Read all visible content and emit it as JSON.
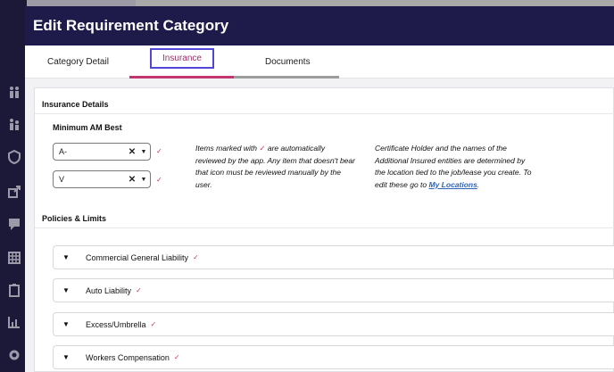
{
  "modal": {
    "title": "Edit Requirement Category"
  },
  "tabs": [
    {
      "label": "Category Detail",
      "active": false
    },
    {
      "label": "Insurance",
      "active": true
    },
    {
      "label": "Documents",
      "active": false
    }
  ],
  "insurance_details": {
    "heading": "Insurance Details",
    "min_am_best_label": "Minimum AM Best",
    "rating_select": {
      "value": "A-"
    },
    "size_select": {
      "value": "V"
    },
    "clear_glyph": "✕",
    "caret_glyph": "▼",
    "auto_review_glyph": "✓",
    "note_left_part1": "Items marked with",
    "note_left_part2": "are automatically reviewed by the app. Any item that doesn't bear that icon must be reviewed manually by the user.",
    "note_right_text": "Certificate Holder and the names of the Additional Insured entities are determined by the location tied to the job/lease you create. To edit these go to",
    "note_right_link": "My Locations",
    "note_right_end": "."
  },
  "policies": {
    "heading": "Policies & Limits",
    "items": [
      {
        "label": "Commercial General Liability",
        "expand_glyph": "▼"
      },
      {
        "label": "Auto Liability",
        "expand_glyph": "▼"
      },
      {
        "label": "Excess/Umbrella",
        "expand_glyph": "▼"
      },
      {
        "label": "Workers Compensation",
        "expand_glyph": "▼"
      }
    ]
  },
  "colors": {
    "header_bg": "#1e1b4b",
    "accent": "#c2356f",
    "tab_focus": "#5246d6",
    "link": "#2f63b8"
  }
}
